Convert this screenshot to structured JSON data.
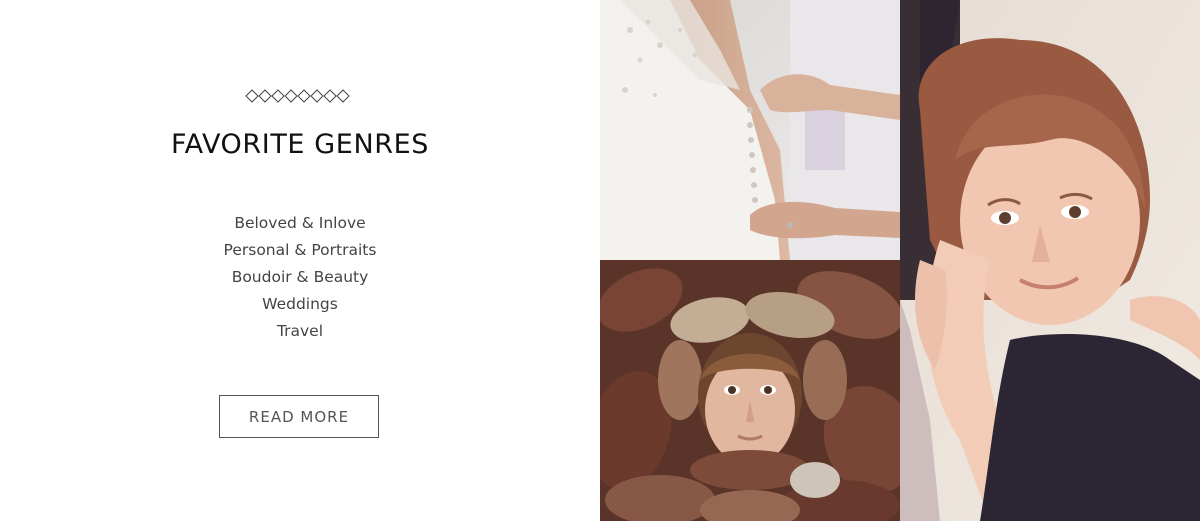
{
  "genres_section": {
    "title": "FAVORITE GENRES",
    "items": [
      "Beloved & Inlove",
      "Personal & Portraits",
      "Boudoir & Beauty",
      "Weddings",
      "Travel"
    ],
    "read_more_label": "READ MORE"
  },
  "icons": {
    "ornament": "diamond-row-ornament"
  },
  "photos": [
    {
      "subject": "bride-wedding-dress-buttons"
    },
    {
      "subject": "child-in-autumn-leaves"
    },
    {
      "subject": "girl-hugging-portrait"
    }
  ],
  "colors": {
    "title": "#111111",
    "text": "#444444",
    "button_border": "#555555",
    "background": "#ffffff"
  }
}
